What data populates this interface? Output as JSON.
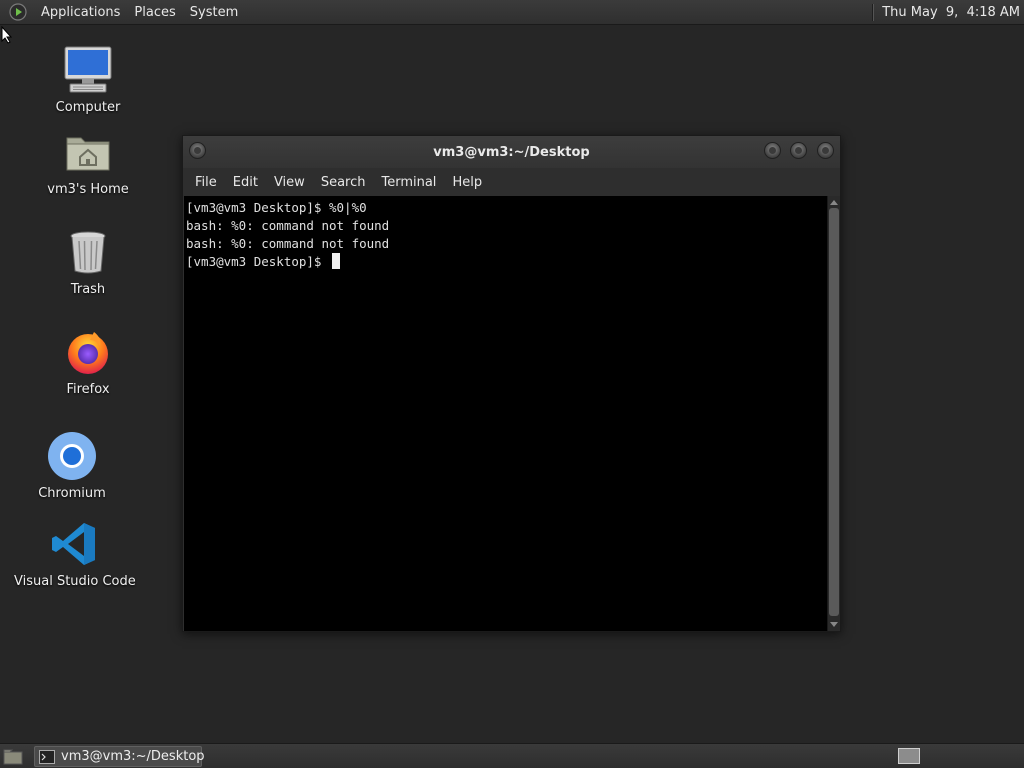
{
  "top_panel": {
    "menus": [
      "Applications",
      "Places",
      "System"
    ],
    "clock": "Thu May  9,  4:18 AM"
  },
  "desktop_icons": [
    {
      "label": "Computer",
      "icon": "computer-icon"
    },
    {
      "label": "vm3's Home",
      "icon": "home-folder-icon"
    },
    {
      "label": "Trash",
      "icon": "trash-icon"
    },
    {
      "label": "Firefox",
      "icon": "firefox-icon"
    },
    {
      "label": "Chromium",
      "icon": "chromium-icon"
    },
    {
      "label": "Visual Studio Code",
      "icon": "vscode-icon"
    }
  ],
  "terminal": {
    "title": "vm3@vm3:~/Desktop",
    "menus": [
      "File",
      "Edit",
      "View",
      "Search",
      "Terminal",
      "Help"
    ],
    "lines": [
      "[vm3@vm3 Desktop]$ %0|%0",
      "bash: %0: command not found",
      "bash: %0: command not found",
      "[vm3@vm3 Desktop]$ "
    ]
  },
  "taskbar": {
    "task_label": "vm3@vm3:~/Desktop"
  },
  "colors": {
    "desktop_bg": "#262626",
    "panel_bg": "#333333",
    "terminal_bg": "#000000",
    "terminal_fg": "#e0e0e0"
  }
}
